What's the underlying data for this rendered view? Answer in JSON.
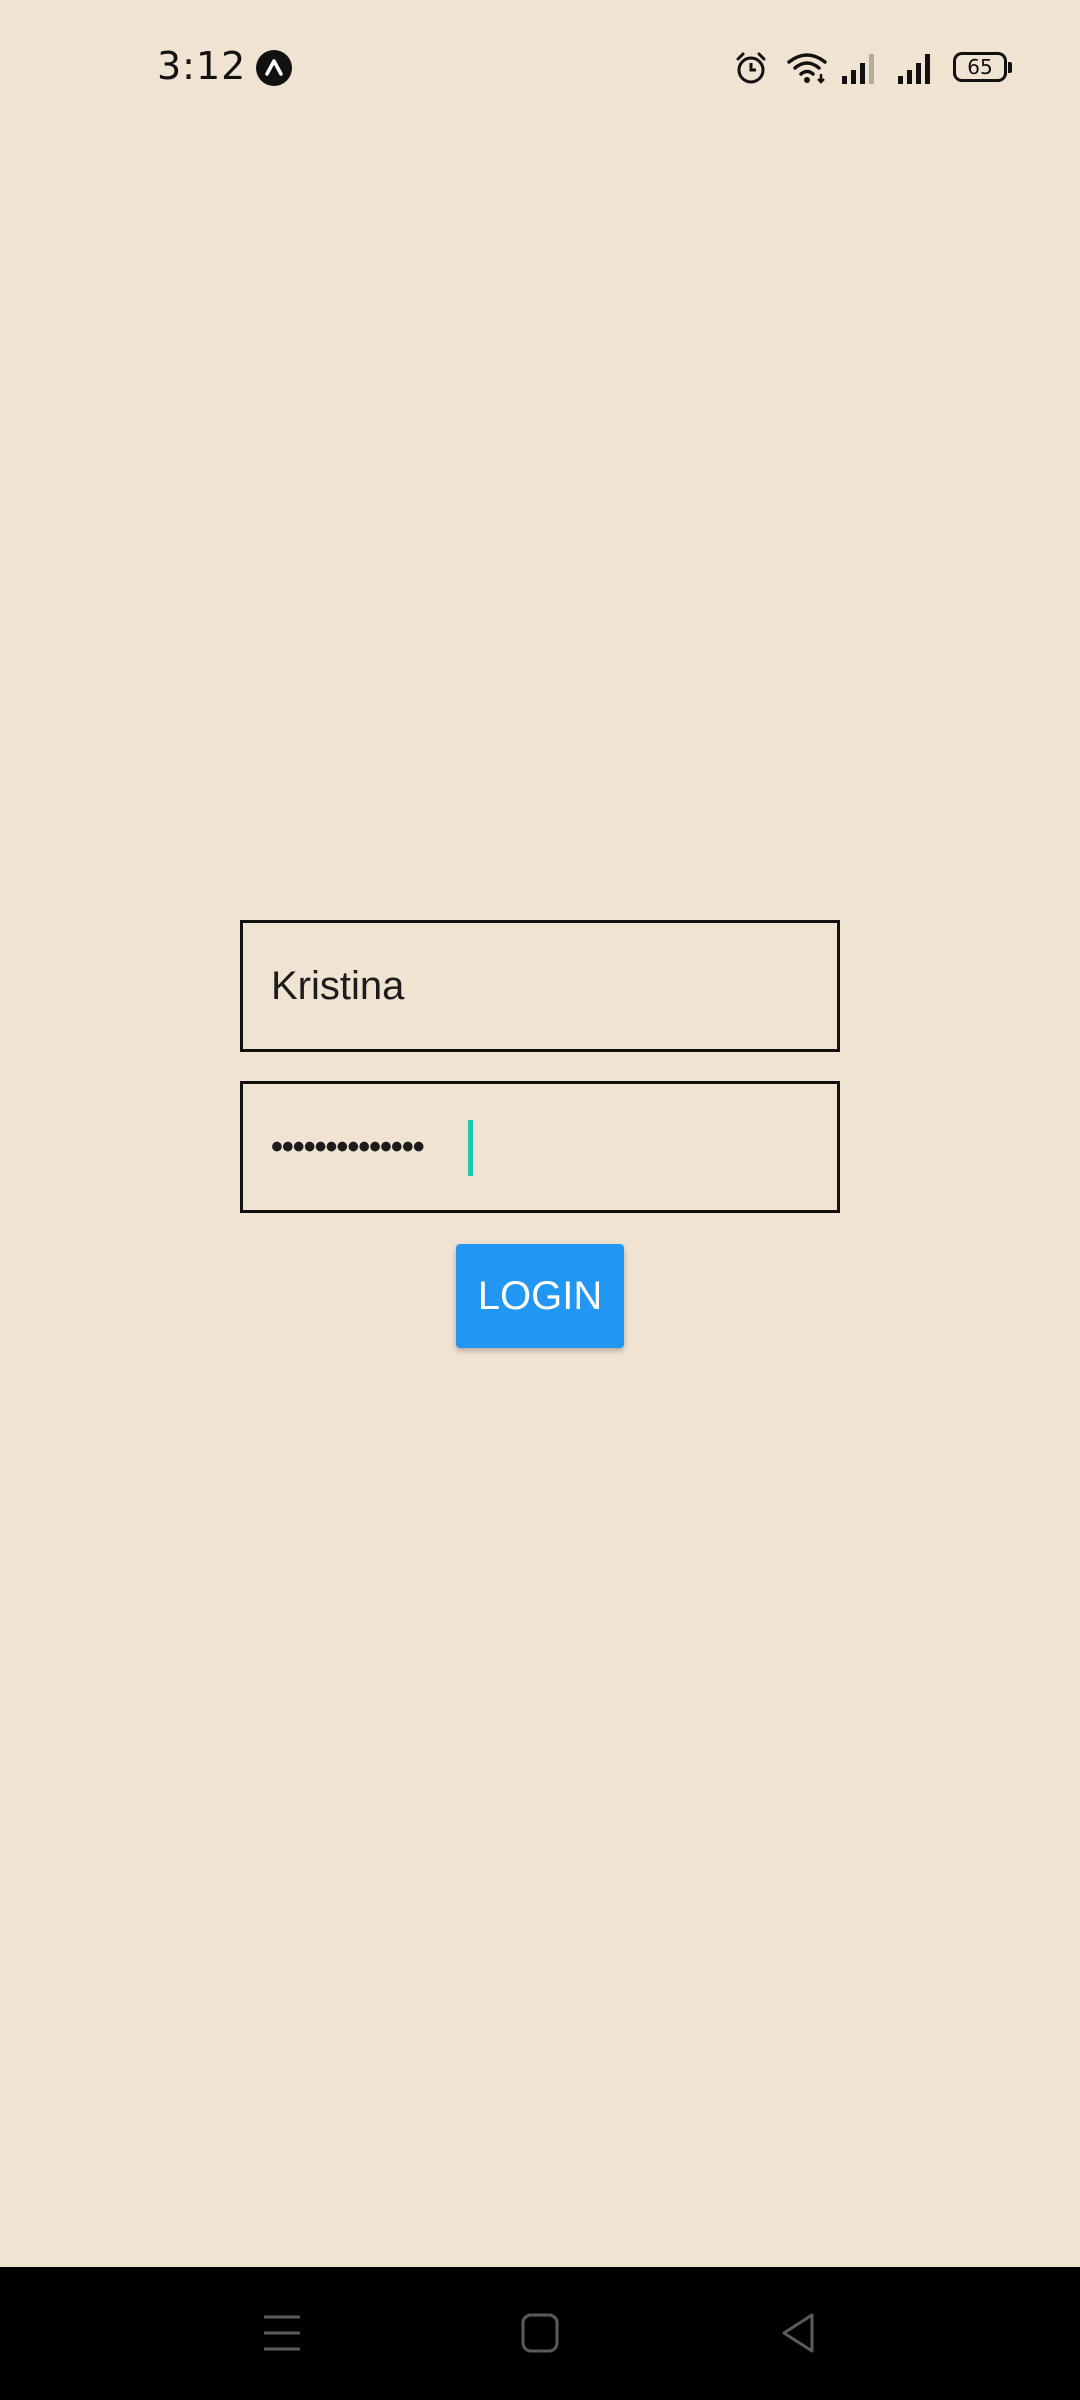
{
  "status_bar": {
    "time": "3:12",
    "battery_level": "65",
    "icons": [
      "app-notification-icon",
      "alarm-icon",
      "wifi-icon",
      "signal-icon",
      "signal-icon",
      "battery-icon"
    ]
  },
  "login_form": {
    "username": {
      "value": "Kristina"
    },
    "password": {
      "masked_value": "••••••••••••••",
      "caret_color": "#1ec9b0"
    },
    "login_label": "LOGIN"
  },
  "colors": {
    "background": "#f0e3d2",
    "button": "#2196f3",
    "nav_bar": "#000000"
  },
  "nav_bar": {
    "buttons": [
      "menu-icon",
      "home-icon",
      "back-icon"
    ]
  }
}
